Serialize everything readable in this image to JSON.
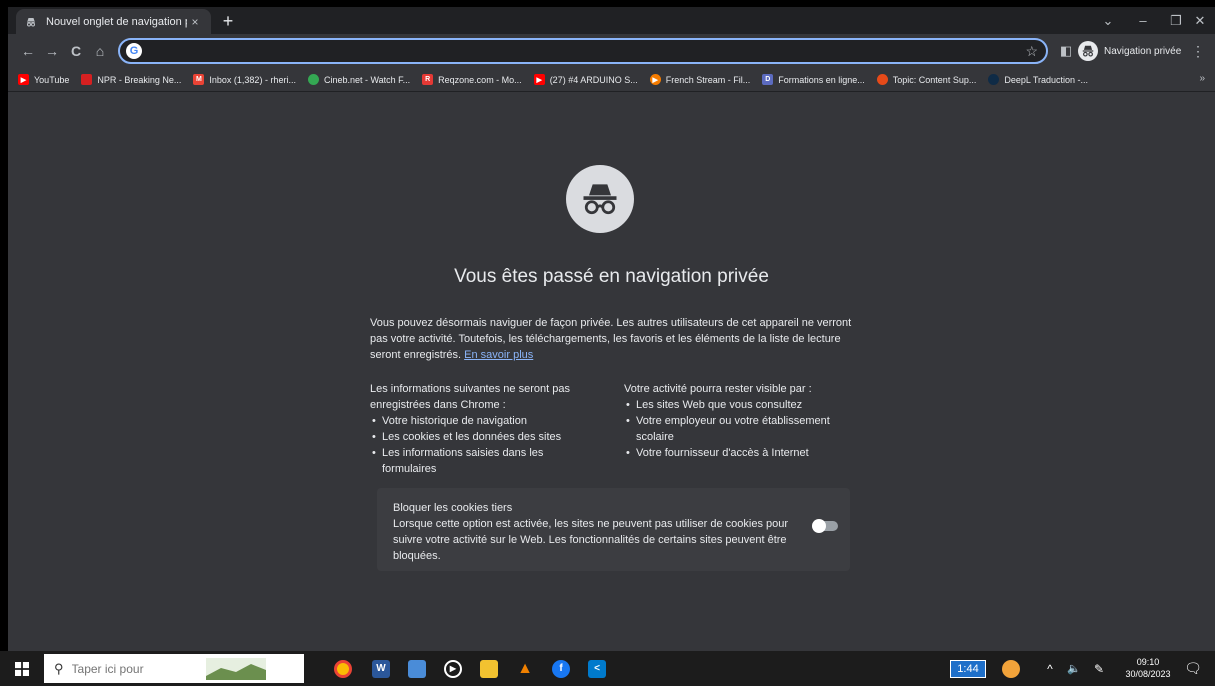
{
  "tab": {
    "title": "Nouvel onglet de navigation priv",
    "close": "×"
  },
  "newtab": "+",
  "window_controls": {
    "dropdown": "⌄",
    "minimize": "–",
    "restore": "❐",
    "close": "✕"
  },
  "toolbar": {
    "back": "←",
    "forward": "→",
    "reload": "C",
    "home": "⌂",
    "omnibox_value": "",
    "bookmark_star": "☆",
    "sidebar": "◧",
    "menu": "⋮",
    "incognito_label": "Navigation privée"
  },
  "bookmarks": [
    {
      "label": "YouTube",
      "color": "#ff0000"
    },
    {
      "label": "NPR - Breaking Ne...",
      "color": "#d62021"
    },
    {
      "label": "Inbox (1,382) - rheri...",
      "color": "#ea4335"
    },
    {
      "label": "Cineb.net - Watch F...",
      "color": "#34a853"
    },
    {
      "label": "Reqzone.com - Mo...",
      "color": "#e53935"
    },
    {
      "label": "(27) #4 ARDUINO S...",
      "color": "#ff0000"
    },
    {
      "label": "French Stream - Fil...",
      "color": "#f57c00"
    },
    {
      "label": "Formations en ligne...",
      "color": "#5c6bc0"
    },
    {
      "label": "Topic: Content Sup...",
      "color": "#e64a19"
    },
    {
      "label": "DeepL Traduction -...",
      "color": "#0f2b46"
    }
  ],
  "bookmarks_more": "»",
  "content": {
    "heading": "Vous êtes passé en navigation privée",
    "intro": "Vous pouvez désormais naviguer de façon privée. Les autres utilisateurs de cet appareil ne verront pas votre activité. Toutefois, les téléchargements, les favoris et les éléments de la liste de lecture seront enregistrés.",
    "learn_more": "En savoir plus",
    "left_title": "Les informations suivantes ne seront pas enregistrées dans Chrome :",
    "left_items": [
      "Votre historique de navigation",
      "Les cookies et les données des sites",
      "Les informations saisies dans les formulaires"
    ],
    "right_title": "Votre activité pourra rester visible par :",
    "right_items": [
      "Les sites Web que vous consultez",
      "Votre employeur ou votre établissement scolaire",
      "Votre fournisseur d'accès à Internet"
    ],
    "cookie_title": "Bloquer les cookies tiers",
    "cookie_desc": "Lorsque cette option est activée, les sites ne peuvent pas utiliser de cookies pour suivre votre activité sur le Web. Les fonctionnalités de certains sites peuvent être bloquées.",
    "cookie_toggle_on": false
  },
  "taskbar": {
    "search_placeholder": "Taper ici pour",
    "tray_counter": "1:44",
    "time": "09:10",
    "date": "30/08/2023"
  }
}
